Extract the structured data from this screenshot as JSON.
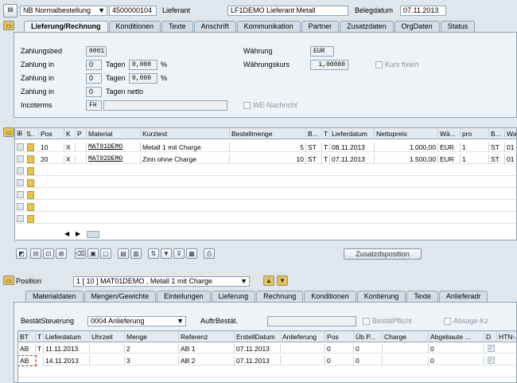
{
  "header": {
    "doc_type": "NB Normalbestellung",
    "po_number": "4500000104",
    "vendor_label": "Lieferant",
    "vendor_value": "LF1DEMO Lieferant Metall",
    "date_label": "Belegdatum",
    "date_value": "07.11.2013"
  },
  "header_tabs": [
    "Lieferung/Rechnung",
    "Konditionen",
    "Texte",
    "Anschrift",
    "Kommunikation",
    "Partner",
    "Zusatzdaten",
    "OrgDaten",
    "Status"
  ],
  "delivery": {
    "zahlungsbed_label": "Zahlungsbed",
    "zahlungsbed_value": "0001",
    "zahlung1_label": "Zahlung in",
    "zahlung1_days": "0",
    "zahlung1_pct": "0,000",
    "zahlung2_label": "Zahlung in",
    "zahlung2_days": "0",
    "zahlung2_pct": "0,000",
    "zahlung3_label": "Zahlung in",
    "zahlung3_days": "0",
    "tagen_label": "Tagen",
    "tagen_netto_label": "Tagen netto",
    "percent": "%",
    "incoterms_label": "Incoterms",
    "incoterms_value": "FH",
    "waehrung_label": "Währung",
    "waehrung_value": "EUR",
    "kurs_label": "Währungskurs",
    "kurs_value": "1,00000",
    "kurs_fix_label": "Kurs fixiert",
    "we_nachricht_label": "WE-Nachricht"
  },
  "items_table": {
    "columns": [
      "S..",
      "Pos",
      "K",
      "P",
      "Material",
      "Kurztext",
      "Bestellmenge",
      "B...",
      "T",
      "Lieferdatum",
      "Nettopreis",
      "Wä...",
      "pro",
      "B...",
      "Wa"
    ],
    "rows": [
      {
        "pos": "10",
        "k": "X",
        "p": "",
        "material": "MAT01DEMO",
        "kurztext": "Metall 1 mit Charge",
        "menge": "5",
        "b": "ST",
        "t": "T",
        "lieferdatum": "08.11.2013",
        "preis": "1.000,00",
        "waehr": "EUR",
        "pro": "1",
        "b2": "ST",
        "wa": "01"
      },
      {
        "pos": "20",
        "k": "X",
        "p": "",
        "material": "MAT02DEMO",
        "kurztext": "Zinn ohne Charge",
        "menge": "10",
        "b": "ST",
        "t": "T",
        "lieferdatum": "07.11.2013",
        "preis": "1.500,00",
        "waehr": "EUR",
        "pro": "1",
        "b2": "ST",
        "wa": "01"
      }
    ]
  },
  "zusatz_button": "Zusatzdsposition",
  "position": {
    "label": "Position",
    "value": "1 [ 10 ] MAT01DEMO , Metall 1 mit Charge"
  },
  "item_tabs": [
    "Materialdaten",
    "Mengen/Gewichte",
    "Einteilungen",
    "Lieferung",
    "Rechnung",
    "Konditionen",
    "Kontierung",
    "Texte",
    "Anlieferadr"
  ],
  "confirm": {
    "steuerung_label": "BestätSteuerung",
    "steuerung_value": "0004 Anlieferung",
    "auftr_label": "AuftrBestät.",
    "pflicht_label": "BestätPflicht",
    "absage_label": "Absage-Kz"
  },
  "conf_table": {
    "columns": [
      "BT",
      "T",
      "Lieferdatum",
      "Uhrzeit",
      "Menge",
      "Referenz",
      "ErstellDatum",
      "Anlieferung",
      "Pos",
      "Üb.P...",
      "Charge",
      "Abgebaute ...",
      "D",
      "HTN-..."
    ],
    "rows": [
      {
        "bt": "AB",
        "t": "T",
        "datum": "11.11.2013",
        "uhr": "",
        "menge": "2",
        "ref": "AB 1",
        "erstell": "07.11.2013",
        "anl": "",
        "pos": "0",
        "ub": "0",
        "charge": "",
        "abg": "0"
      },
      {
        "bt": "AB",
        "t": "",
        "datum": "14.11.2013",
        "uhr": "",
        "menge": "3",
        "ref": "AB 2",
        "erstell": "07.11.2013",
        "anl": "",
        "pos": "0",
        "ub": "0",
        "charge": "",
        "abg": "0"
      }
    ]
  }
}
